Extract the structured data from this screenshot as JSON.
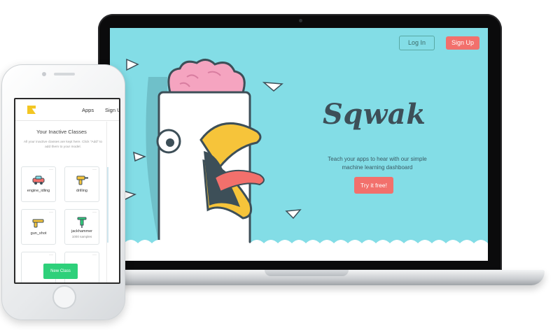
{
  "laptop": {
    "nav": {
      "login_label": "Log In",
      "signup_label": "Sign Up"
    },
    "hero": {
      "brand": "Sqwak",
      "tagline": "Teach your apps to hear with our simple machine learning dashboard",
      "cta_label": "Try it free!"
    },
    "colors": {
      "background": "#83dde6",
      "accent": "#f2706c",
      "brand_text": "#3d4f58"
    }
  },
  "phone": {
    "nav": {
      "apps_label": "Apps",
      "signup_label": "Sign U"
    },
    "section_title": "Your Inactive Classes",
    "section_description": "All your inactive classes are kept here. Click \"Add\" to add them to your model.",
    "cards": [
      {
        "label": "engine_idling",
        "sub": "",
        "icon": "car-icon"
      },
      {
        "label": "drilling",
        "sub": "",
        "icon": "drill-icon"
      },
      {
        "label": "gun_shot",
        "sub": "",
        "icon": "gun-icon"
      },
      {
        "label": "jackhammer",
        "sub": "1000 samples",
        "icon": "jackhammer-icon"
      }
    ],
    "new_class_label": "New Class",
    "colors": {
      "primary": "#2ed07a",
      "logo": "#f3c623"
    }
  }
}
